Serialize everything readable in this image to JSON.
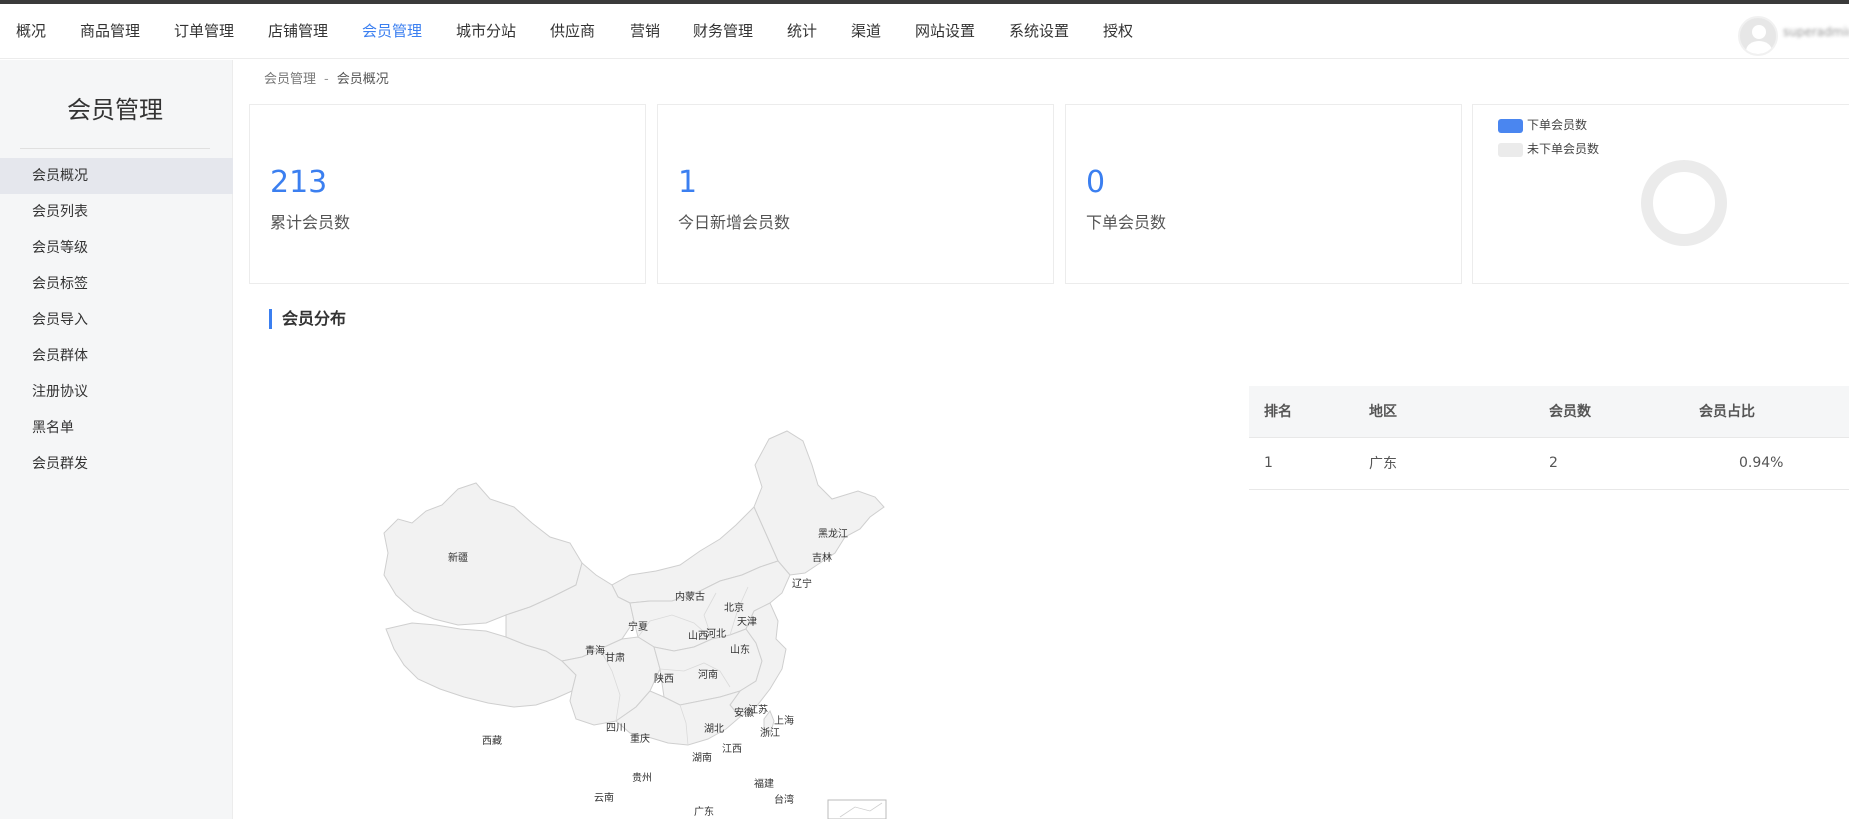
{
  "nav": {
    "items": [
      {
        "label": "概况"
      },
      {
        "label": "商品管理"
      },
      {
        "label": "订单管理"
      },
      {
        "label": "店铺管理"
      },
      {
        "label": "会员管理"
      },
      {
        "label": "城市分站"
      },
      {
        "label": "供应商"
      },
      {
        "label": "营销"
      },
      {
        "label": "财务管理"
      },
      {
        "label": "统计"
      },
      {
        "label": "渠道"
      },
      {
        "label": "网站设置"
      },
      {
        "label": "系统设置"
      },
      {
        "label": "授权"
      }
    ],
    "active": "会员管理",
    "username": "superadmin"
  },
  "sidebar": {
    "title": "会员管理",
    "items": [
      {
        "label": "会员概况"
      },
      {
        "label": "会员列表"
      },
      {
        "label": "会员等级"
      },
      {
        "label": "会员标签"
      },
      {
        "label": "会员导入"
      },
      {
        "label": "会员群体"
      },
      {
        "label": "注册协议"
      },
      {
        "label": "黑名单"
      },
      {
        "label": "会员群发"
      }
    ],
    "active": "会员概况"
  },
  "breadcrumb": {
    "parent": "会员管理",
    "separator": "-",
    "current": "会员概况"
  },
  "stats": [
    {
      "value": "213",
      "label": "累计会员数"
    },
    {
      "value": "1",
      "label": "今日新增会员数"
    },
    {
      "value": "0",
      "label": "下单会员数"
    }
  ],
  "donut": {
    "legend": [
      {
        "label": "下单会员数",
        "color": "#4a86f0"
      },
      {
        "label": "未下单会员数",
        "color": "#ebebeb"
      }
    ],
    "values": [
      0,
      213
    ]
  },
  "section_title": "会员分布",
  "map": {
    "provinces": [
      "黑龙江",
      "吉林",
      "辽宁",
      "内蒙古",
      "北京",
      "天津",
      "河北",
      "山西",
      "山东",
      "宁夏",
      "青海",
      "甘肃",
      "陕西",
      "河南",
      "新疆",
      "西藏",
      "四川",
      "重庆",
      "湖北",
      "安徽",
      "江苏",
      "上海",
      "浙江",
      "湖南",
      "江西",
      "福建",
      "贵州",
      "云南",
      "广东",
      "台湾"
    ]
  },
  "table": {
    "headers": [
      "排名",
      "地区",
      "会员数",
      "会员占比"
    ],
    "rows": [
      [
        "1",
        "广东",
        "2",
        "0.94%"
      ]
    ]
  }
}
